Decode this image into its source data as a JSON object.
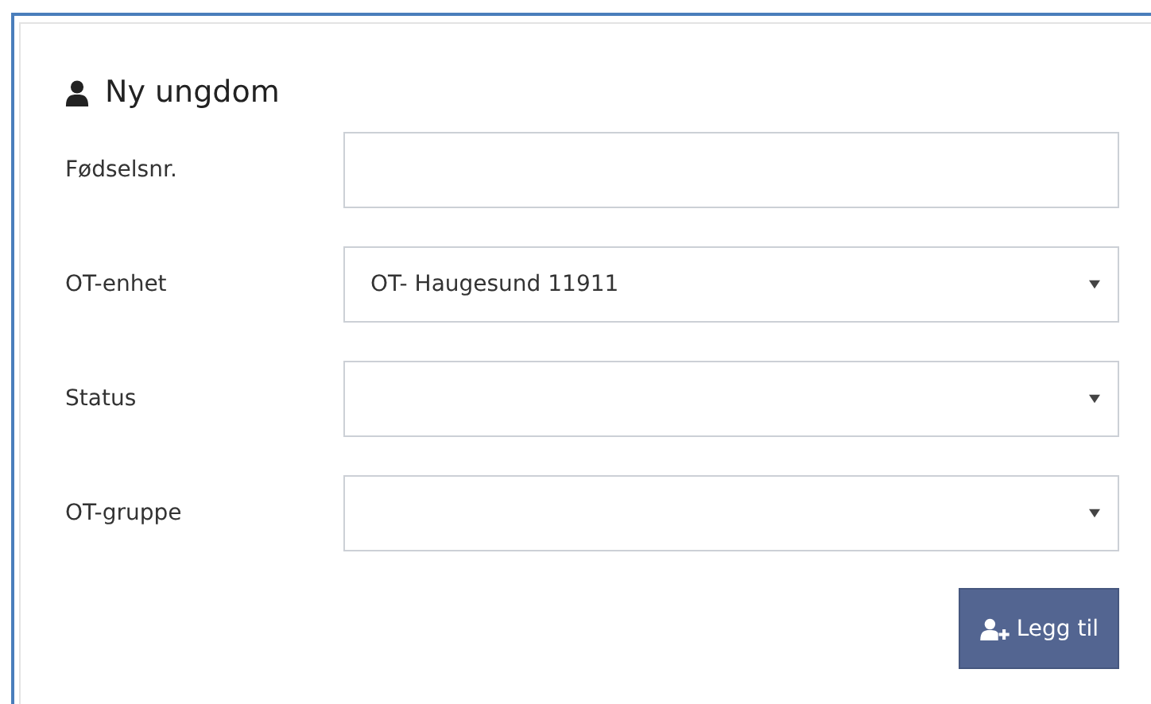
{
  "panel": {
    "title": "Ny ungdom"
  },
  "fields": [
    {
      "label": "Fødselsnr.",
      "kind": "input"
    },
    {
      "label": "OT-enhet",
      "kind": "select",
      "value": "OT- Haugesund 11911"
    },
    {
      "label": "Status",
      "kind": "select"
    },
    {
      "label": "OT-gruppe",
      "kind": "select"
    }
  ],
  "button": {
    "label": "Legg til"
  }
}
